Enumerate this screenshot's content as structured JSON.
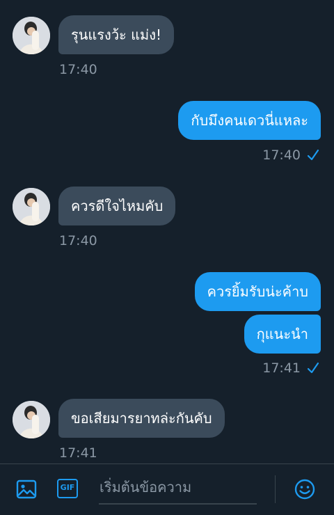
{
  "messages": [
    {
      "side": "in",
      "text": "รุนแรงว้ะ แม่ง!",
      "time": "17:40"
    },
    {
      "side": "out",
      "text": "กับมึงคนเดวนี่แหละ",
      "time": "17:40"
    },
    {
      "side": "in",
      "text": "ควรดีใจไหมคับ",
      "time": "17:40"
    },
    {
      "side": "out",
      "text": "ควรยิ้มรับน่ะค้าบ"
    },
    {
      "side": "out",
      "text": "กุแนะนำ",
      "time": "17:41"
    },
    {
      "side": "in",
      "text": "ขอเสียมารยาทล่ะกันคับ",
      "time": "17:41"
    }
  ],
  "composer": {
    "placeholder": "เริ่มต้นข้อความ",
    "gif_label": "GIF",
    "icons": [
      "image-icon",
      "gif-icon",
      "emoji-icon"
    ]
  },
  "colors": {
    "background": "#15202b",
    "incoming": "#3b4b5b",
    "outgoing": "#1d9bf0",
    "accent": "#1d9bf0"
  }
}
